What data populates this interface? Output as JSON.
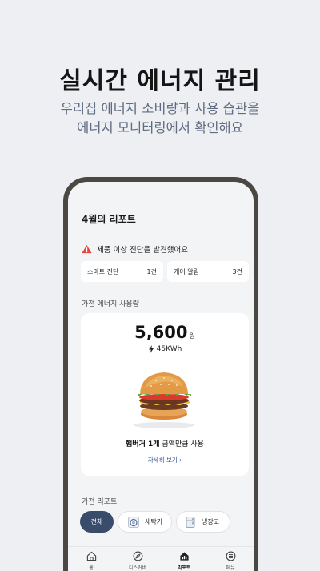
{
  "hero": {
    "title": "실시간 에너지 관리",
    "subtitle_line1": "우리집 에너지 소비량과 사용 습관을",
    "subtitle_line2": "에너지 모니터링에서 확인해요"
  },
  "report": {
    "title": "4월의 리포트",
    "alert_text": "제품 이상 진단을 발견했어요",
    "chips": [
      {
        "label": "스마트 진단",
        "value": "1건"
      },
      {
        "label": "케어 알림",
        "value": "3건"
      }
    ]
  },
  "energy": {
    "section_label": "가전 에너지 사용량",
    "amount": "5,600",
    "unit": "원",
    "kwh": "45KWh",
    "comparison_bold": "햄버거 1개",
    "comparison_rest": " 금액만큼 사용",
    "detail_link": "자세히 보기"
  },
  "appliance_report": {
    "section_label": "가전 리포트",
    "filters": [
      {
        "label": "전체",
        "selected": true
      },
      {
        "label": "세탁기",
        "icon": "washer-icon"
      },
      {
        "label": "냉장고",
        "icon": "fridge-icon"
      }
    ]
  },
  "tabbar": {
    "items": [
      {
        "label": "홈",
        "icon": "home-icon"
      },
      {
        "label": "디스커버",
        "icon": "compass-icon"
      },
      {
        "label": "리포트",
        "icon": "report-icon",
        "active": true
      },
      {
        "label": "메뉴",
        "icon": "menu-icon"
      }
    ]
  },
  "colors": {
    "background": "#eeeff2",
    "phone_frame": "#4b4743",
    "accent_navy": "#3a4c6b",
    "link_blue": "#2c4f8c",
    "warning_red": "#e8473f"
  }
}
